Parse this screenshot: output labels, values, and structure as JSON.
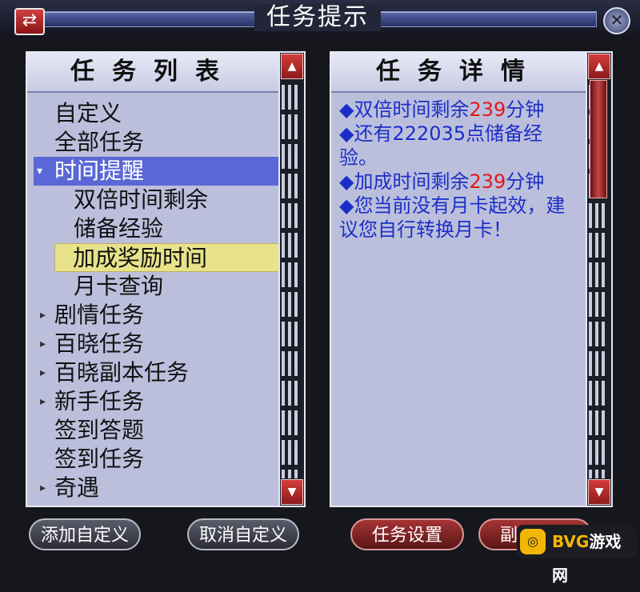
{
  "window": {
    "title": "任务提示",
    "swap_icon": "⇄",
    "close_icon": "✕"
  },
  "left_panel": {
    "header": "任务列表",
    "items": [
      {
        "label": "自定义",
        "caret": ""
      },
      {
        "label": "全部任务",
        "caret": ""
      },
      {
        "label": "时间提醒",
        "caret": "▾"
      },
      {
        "label": "双倍时间剩余",
        "caret": ""
      },
      {
        "label": "储备经验",
        "caret": ""
      },
      {
        "label": "加成奖励时间",
        "caret": ""
      },
      {
        "label": "月卡查询",
        "caret": ""
      },
      {
        "label": "剧情任务",
        "caret": "▸"
      },
      {
        "label": "百晓任务",
        "caret": "▸"
      },
      {
        "label": "百晓副本任务",
        "caret": "▸"
      },
      {
        "label": "新手任务",
        "caret": "▸"
      },
      {
        "label": "签到答题",
        "caret": ""
      },
      {
        "label": "签到任务",
        "caret": ""
      },
      {
        "label": "奇遇",
        "caret": "▸"
      }
    ]
  },
  "right_panel": {
    "header": "任务详情",
    "lines": [
      {
        "bullet": "◆",
        "pre": "双倍时间剩余",
        "num": "239",
        "post": "分钟"
      },
      {
        "bullet": "◆",
        "pre": "还有222035点储备经验。",
        "num": "",
        "post": ""
      },
      {
        "bullet": "◆",
        "pre": "加成时间剩余",
        "num": "239",
        "post": "分钟"
      },
      {
        "bullet": "◆",
        "pre": "您当前没有月卡起效，建议您自行转换月卡！",
        "num": "",
        "post": ""
      }
    ]
  },
  "scroll": {
    "up": "▲",
    "down": "▼"
  },
  "buttons": {
    "add_custom": "添加自定义",
    "cancel_custom": "取消自定义",
    "task_settings": "任务设置",
    "dungeon_intro": "副本介绍"
  },
  "watermark": {
    "badge": "◎",
    "text_a": "BVG",
    "text_b": "游戏网"
  }
}
